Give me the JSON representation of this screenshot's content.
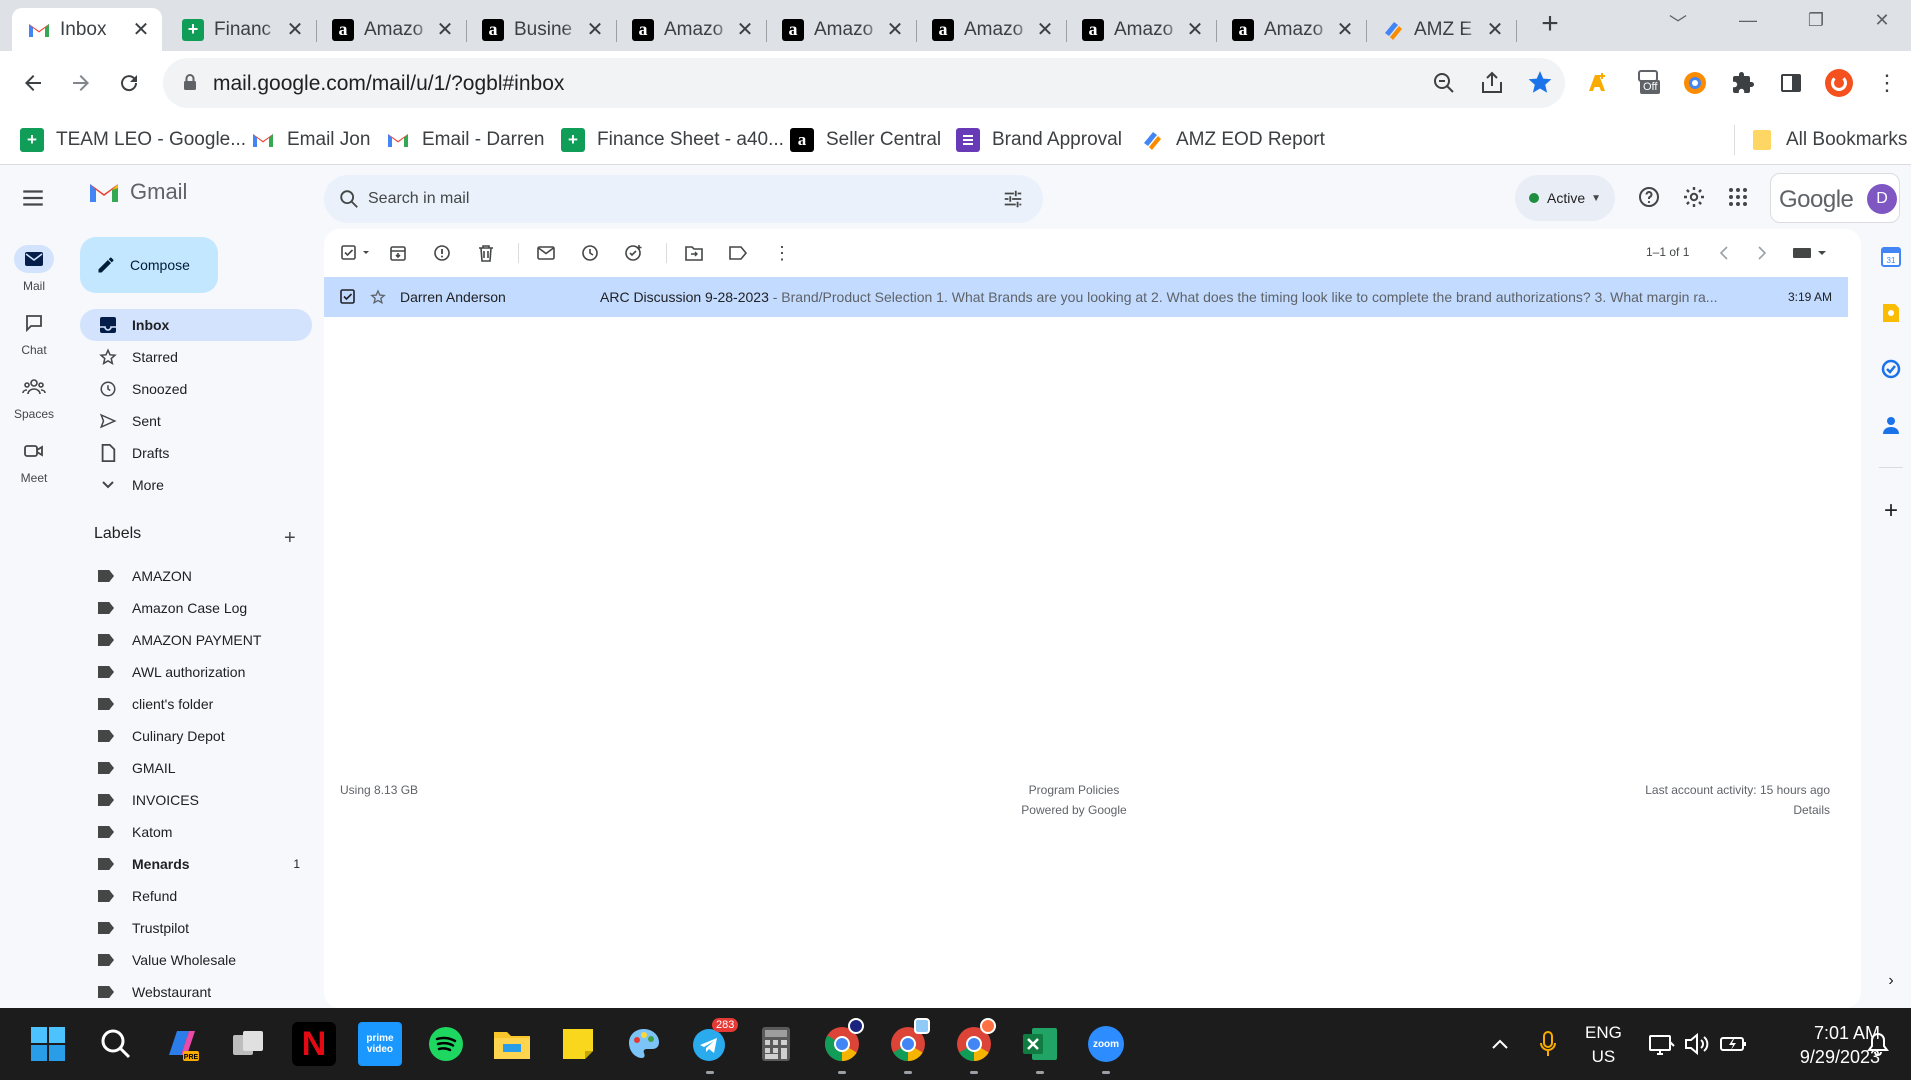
{
  "browser": {
    "tabs": [
      {
        "title": "Inbox",
        "icon": "gmail-icon",
        "active": true
      },
      {
        "title": "Financ",
        "icon": "sheets-icon"
      },
      {
        "title": "Amazo",
        "icon": "amazon-icon"
      },
      {
        "title": "Busine",
        "icon": "amazon-icon"
      },
      {
        "title": "Amazo",
        "icon": "amazon-icon"
      },
      {
        "title": "Amazo",
        "icon": "amazon-icon"
      },
      {
        "title": "Amazo",
        "icon": "amazon-icon"
      },
      {
        "title": "Amazo",
        "icon": "amazon-icon"
      },
      {
        "title": "Amazo",
        "icon": "amazon-icon"
      },
      {
        "title": "AMZ E",
        "icon": "amz-report-icon"
      }
    ],
    "url": "mail.google.com/mail/u/1/?ogbl#inbox",
    "bookmarks": [
      {
        "label": "TEAM LEO - Google...",
        "icon": "sheets-icon"
      },
      {
        "label": "Email Jon",
        "icon": "gmail-icon"
      },
      {
        "label": "Email - Darren",
        "icon": "gmail-icon"
      },
      {
        "label": "Finance Sheet - a40...",
        "icon": "sheets-icon"
      },
      {
        "label": "Seller Central",
        "icon": "amazon-icon"
      },
      {
        "label": "Brand Approval",
        "icon": "forms-icon"
      },
      {
        "label": "AMZ EOD Report",
        "icon": "amz-report-icon"
      }
    ],
    "all_bookmarks": "All Bookmarks",
    "extension_badge": "Off"
  },
  "gmail": {
    "product": "Gmail",
    "rail": [
      {
        "label": "Mail",
        "icon": "mail-icon",
        "active": true
      },
      {
        "label": "Chat",
        "icon": "chat-icon"
      },
      {
        "label": "Spaces",
        "icon": "spaces-icon"
      },
      {
        "label": "Meet",
        "icon": "meet-icon"
      }
    ],
    "search_placeholder": "Search in mail",
    "status": "Active",
    "google_label": "Google",
    "avatar_letter": "D",
    "compose": "Compose",
    "nav": [
      {
        "label": "Inbox",
        "icon": "inbox-icon",
        "active": true
      },
      {
        "label": "Starred",
        "icon": "star-icon"
      },
      {
        "label": "Snoozed",
        "icon": "clock-icon"
      },
      {
        "label": "Sent",
        "icon": "send-icon"
      },
      {
        "label": "Drafts",
        "icon": "draft-icon"
      },
      {
        "label": "More",
        "icon": "chevron-down-icon"
      }
    ],
    "labels_title": "Labels",
    "labels": [
      {
        "name": "AMAZON"
      },
      {
        "name": "Amazon Case Log"
      },
      {
        "name": "AMAZON PAYMENT"
      },
      {
        "name": "AWL authorization"
      },
      {
        "name": "client's folder"
      },
      {
        "name": "Culinary Depot"
      },
      {
        "name": "GMAIL"
      },
      {
        "name": "INVOICES"
      },
      {
        "name": "Katom"
      },
      {
        "name": "Menards",
        "count": "1",
        "bold": true
      },
      {
        "name": "Refund"
      },
      {
        "name": "Trustpilot"
      },
      {
        "name": "Value Wholesale"
      },
      {
        "name": "Webstaurant"
      }
    ],
    "pager": "1–1 of 1",
    "email": {
      "sender": "Darren Anderson",
      "subject": "ARC Discussion 9-28-2023",
      "snippet": " - Brand/Product Selection 1. What Brands are you looking at 2. What does the timing look like to complete the brand authorizations? 3. What margin ra...",
      "time": "3:19 AM"
    },
    "footer": {
      "storage": "Using 8.13 GB",
      "policies": "Program Policies",
      "powered": "Powered by Google",
      "activity": "Last account activity: 15 hours ago",
      "details": "Details"
    }
  },
  "taskbar": {
    "telegram_badge": "283",
    "lang": "ENG",
    "region": "US",
    "time": "7:01 AM",
    "date": "9/29/2023"
  },
  "colors": {
    "chrome_frame": "#dee1e6",
    "gmail_bg": "#f6f8fc",
    "compose_bg": "#c2e7ff",
    "selected_row": "#c2dbff",
    "active_nav": "#d3e3fd",
    "taskbar": "#1c1c1c"
  }
}
